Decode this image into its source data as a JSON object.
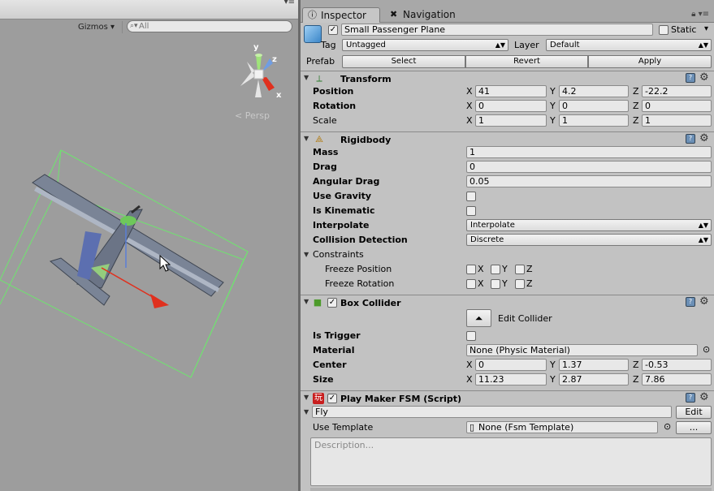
{
  "scene": {
    "toolbar": {
      "gizmos_label": "Gizmos ▾",
      "search_placeholder": "All"
    },
    "projection_label": "Persp",
    "gizmo_axes": {
      "y": "y",
      "z": "z",
      "x": "x"
    }
  },
  "tabs": {
    "inspector": "Inspector",
    "navigation": "Navigation"
  },
  "object": {
    "name": "Small Passenger Plane",
    "active": true,
    "static_label": "Static",
    "tag_label": "Tag",
    "tag_value": "Untagged",
    "layer_label": "Layer",
    "layer_value": "Default",
    "prefab_label": "Prefab",
    "prefab_buttons": {
      "select": "Select",
      "revert": "Revert",
      "apply": "Apply"
    }
  },
  "transform": {
    "title": "Transform",
    "position_label": "Position",
    "rotation_label": "Rotation",
    "scale_label": "Scale",
    "axes": {
      "x": "X",
      "y": "Y",
      "z": "Z"
    },
    "position": {
      "x": "41",
      "y": "4.2",
      "z": "-22.2"
    },
    "rotation": {
      "x": "0",
      "y": "0",
      "z": "0"
    },
    "scale": {
      "x": "1",
      "y": "1",
      "z": "1"
    }
  },
  "rigidbody": {
    "title": "Rigidbody",
    "mass_label": "Mass",
    "mass": "1",
    "drag_label": "Drag",
    "drag": "0",
    "angular_drag_label": "Angular Drag",
    "angular_drag": "0.05",
    "use_gravity_label": "Use Gravity",
    "is_kinematic_label": "Is Kinematic",
    "interpolate_label": "Interpolate",
    "interpolate": "Interpolate",
    "collision_label": "Collision Detection",
    "collision": "Discrete",
    "constraints_label": "Constraints",
    "freeze_position_label": "Freeze Position",
    "freeze_rotation_label": "Freeze Rotation",
    "axes": {
      "x": "X",
      "y": "Y",
      "z": "Z"
    }
  },
  "box_collider": {
    "title": "Box Collider",
    "edit_label": "Edit Collider",
    "is_trigger_label": "Is Trigger",
    "material_label": "Material",
    "material": "None (Physic Material)",
    "center_label": "Center",
    "size_label": "Size",
    "axes": {
      "x": "X",
      "y": "Y",
      "z": "Z"
    },
    "center": {
      "x": "0",
      "y": "1.37",
      "z": "-0.53"
    },
    "size": {
      "x": "11.23",
      "y": "2.87",
      "z": "7.86"
    }
  },
  "playmaker": {
    "title": "Play Maker FSM (Script)",
    "icon_glyph": "玩",
    "fsm_name": "Fly",
    "edit_button": "Edit",
    "use_template_label": "Use Template",
    "template_value": "None (Fsm Template)",
    "template_button": "...",
    "description_placeholder": "Description..."
  },
  "colors": {
    "scene_bg": "#9d9d9d",
    "inspector_bg": "#c2c2c2",
    "collider_green": "#6fe36f",
    "axis_red": "#e0301e"
  }
}
